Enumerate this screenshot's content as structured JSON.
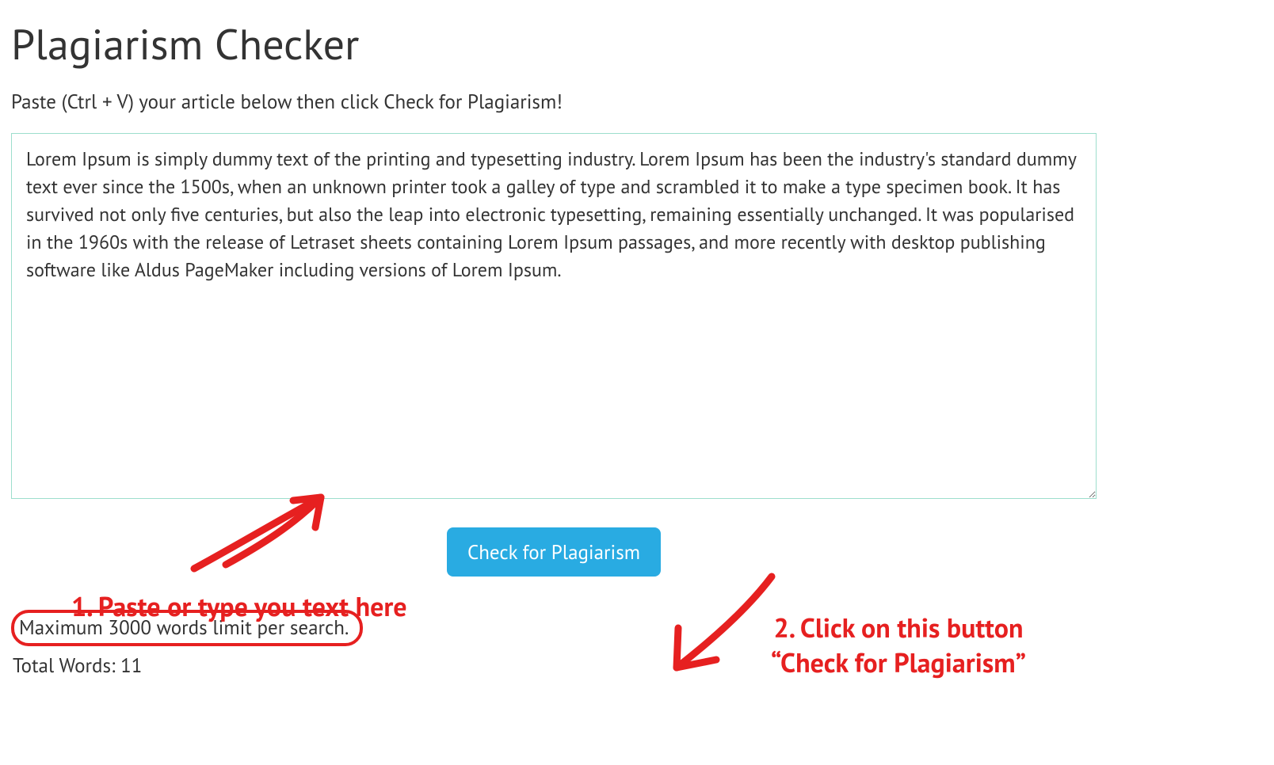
{
  "header": {
    "title": "Plagiarism Checker",
    "subtitle": "Paste (Ctrl + V) your article below then click Check for Plagiarism!"
  },
  "editor": {
    "content": "Lorem Ipsum is simply dummy text of the printing and typesetting industry. Lorem Ipsum has been the industry's standard dummy text ever since the 1500s, when an unknown printer took a galley of type and scrambled it to make a type specimen book. It has survived not only five centuries, but also the leap into electronic typesetting, remaining essentially unchanged. It was popularised in the 1960s with the release of Letraset sheets containing Lorem Ipsum passages, and more recently with desktop publishing software like Aldus PageMaker including versions of Lorem Ipsum."
  },
  "actions": {
    "check_label": "Check for Plagiarism"
  },
  "footer": {
    "limit_text": "Maximum 3000 words limit per search.",
    "total_words_label": "Total Words: 11"
  },
  "annotations": {
    "step1": "1. Paste or type you text here",
    "step2": "2. Click on this button “Check for Plagiarism”"
  },
  "colors": {
    "accent_button": "#29abe2",
    "annotation_red": "#e62020",
    "textarea_border": "#9ddecd"
  }
}
